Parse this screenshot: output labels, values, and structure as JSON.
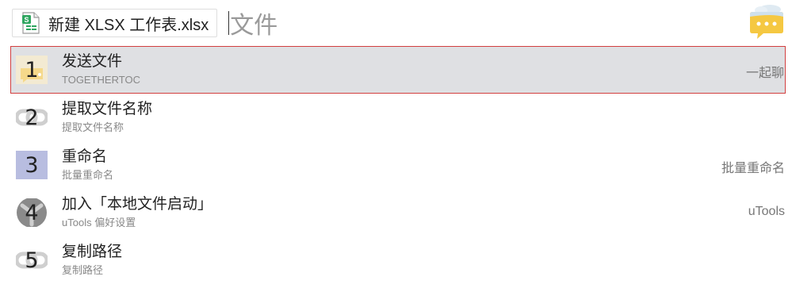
{
  "header": {
    "file_name": "新建 XLSX 工作表.xlsx",
    "file_icon": "spreadsheet-file-icon",
    "query": "文件",
    "logo_icon": "chat-bubble-logo-icon"
  },
  "results": [
    {
      "index": "1",
      "title": "发送文件",
      "subtitle": "TOGETHERTOC",
      "right": "一起聊",
      "icon": "chat-app-icon",
      "selected": true
    },
    {
      "index": "2",
      "title": "提取文件名称",
      "subtitle": "提取文件名称",
      "right": "",
      "icon": "link-icon",
      "selected": false
    },
    {
      "index": "3",
      "title": "重命名",
      "subtitle": "批量重命名",
      "right": "批量重命名",
      "icon": "rename-icon",
      "selected": false
    },
    {
      "index": "4",
      "title": "加入「本地文件启动」",
      "subtitle": "uTools 偏好设置",
      "right": "uTools",
      "icon": "utools-settings-icon",
      "selected": false
    },
    {
      "index": "5",
      "title": "复制路径",
      "subtitle": "复制路径",
      "right": "",
      "icon": "link-icon",
      "selected": false
    }
  ],
  "colors": {
    "selected_bg": "#dfe0e3",
    "selected_border": "#d23f3f",
    "excel_green": "#2fa660",
    "logo_yellow": "#f5c842"
  }
}
